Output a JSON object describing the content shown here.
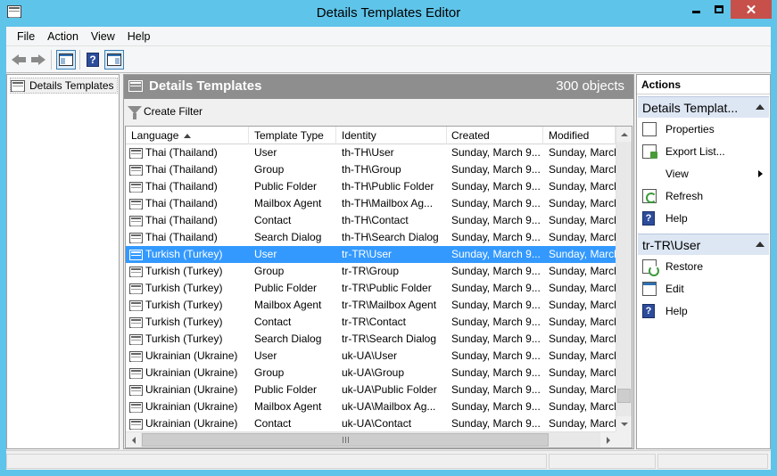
{
  "window": {
    "title": "Details Templates Editor"
  },
  "menu": [
    {
      "label": "File"
    },
    {
      "label": "Action"
    },
    {
      "label": "View"
    },
    {
      "label": "Help"
    }
  ],
  "toolbar": {
    "back_icon": "back-arrow-icon",
    "forward_icon": "forward-arrow-icon",
    "show_hide_console_tree_icon": "console-tree-icon",
    "help_icon": "help-icon",
    "show_hide_action_pane_icon": "action-pane-icon",
    "help_glyph": "?"
  },
  "tree": {
    "items": [
      {
        "label": "Details Templates"
      }
    ]
  },
  "result_pane": {
    "title": "Details Templates",
    "count": "300 objects",
    "create_filter": "Create Filter"
  },
  "list": {
    "columns": [
      {
        "label": "Language",
        "sorted": "ascending"
      },
      {
        "label": "Template Type"
      },
      {
        "label": "Identity"
      },
      {
        "label": "Created"
      },
      {
        "label": "Modified"
      }
    ],
    "rows": [
      {
        "language": "Thai (Thailand)",
        "type": "User",
        "identity": "th-TH\\User",
        "created": "Sunday, March 9...",
        "modified": "Sunday, March"
      },
      {
        "language": "Thai (Thailand)",
        "type": "Group",
        "identity": "th-TH\\Group",
        "created": "Sunday, March 9...",
        "modified": "Sunday, March"
      },
      {
        "language": "Thai (Thailand)",
        "type": "Public Folder",
        "identity": "th-TH\\Public Folder",
        "created": "Sunday, March 9...",
        "modified": "Sunday, March"
      },
      {
        "language": "Thai (Thailand)",
        "type": "Mailbox Agent",
        "identity": "th-TH\\Mailbox Ag...",
        "created": "Sunday, March 9...",
        "modified": "Sunday, March"
      },
      {
        "language": "Thai (Thailand)",
        "type": "Contact",
        "identity": "th-TH\\Contact",
        "created": "Sunday, March 9...",
        "modified": "Sunday, March"
      },
      {
        "language": "Thai (Thailand)",
        "type": "Search Dialog",
        "identity": "th-TH\\Search Dialog",
        "created": "Sunday, March 9...",
        "modified": "Sunday, March"
      },
      {
        "language": "Turkish (Turkey)",
        "type": "User",
        "identity": "tr-TR\\User",
        "created": "Sunday, March 9...",
        "modified": "Sunday, March",
        "selected": true
      },
      {
        "language": "Turkish (Turkey)",
        "type": "Group",
        "identity": "tr-TR\\Group",
        "created": "Sunday, March 9...",
        "modified": "Sunday, March"
      },
      {
        "language": "Turkish (Turkey)",
        "type": "Public Folder",
        "identity": "tr-TR\\Public Folder",
        "created": "Sunday, March 9...",
        "modified": "Sunday, March"
      },
      {
        "language": "Turkish (Turkey)",
        "type": "Mailbox Agent",
        "identity": "tr-TR\\Mailbox Agent",
        "created": "Sunday, March 9...",
        "modified": "Sunday, March"
      },
      {
        "language": "Turkish (Turkey)",
        "type": "Contact",
        "identity": "tr-TR\\Contact",
        "created": "Sunday, March 9...",
        "modified": "Sunday, March"
      },
      {
        "language": "Turkish (Turkey)",
        "type": "Search Dialog",
        "identity": "tr-TR\\Search Dialog",
        "created": "Sunday, March 9...",
        "modified": "Sunday, March"
      },
      {
        "language": "Ukrainian (Ukraine)",
        "type": "User",
        "identity": "uk-UA\\User",
        "created": "Sunday, March 9...",
        "modified": "Sunday, March"
      },
      {
        "language": "Ukrainian (Ukraine)",
        "type": "Group",
        "identity": "uk-UA\\Group",
        "created": "Sunday, March 9...",
        "modified": "Sunday, March"
      },
      {
        "language": "Ukrainian (Ukraine)",
        "type": "Public Folder",
        "identity": "uk-UA\\Public Folder",
        "created": "Sunday, March 9...",
        "modified": "Sunday, March"
      },
      {
        "language": "Ukrainian (Ukraine)",
        "type": "Mailbox Agent",
        "identity": "uk-UA\\Mailbox Ag...",
        "created": "Sunday, March 9...",
        "modified": "Sunday, March"
      },
      {
        "language": "Ukrainian (Ukraine)",
        "type": "Contact",
        "identity": "uk-UA\\Contact",
        "created": "Sunday, March 9...",
        "modified": "Sunday, March"
      }
    ],
    "selected_color": "#3399ff"
  },
  "actions": {
    "title": "Actions",
    "section1": {
      "title": "Details Templat...",
      "items": [
        {
          "label": "Properties",
          "icon": "properties-icon"
        },
        {
          "label": "Export List...",
          "icon": "export-list-icon"
        },
        {
          "label": "View",
          "icon": "",
          "submenu": true
        },
        {
          "label": "Refresh",
          "icon": "refresh-icon"
        },
        {
          "label": "Help",
          "icon": "help-icon"
        }
      ]
    },
    "section2": {
      "title": "tr-TR\\User",
      "items": [
        {
          "label": "Restore",
          "icon": "restore-icon"
        },
        {
          "label": "Edit",
          "icon": "edit-icon"
        },
        {
          "label": "Help",
          "icon": "help-icon"
        }
      ]
    }
  },
  "colors": {
    "title_bar": "#5fc4e9",
    "close_button": "#c7504a",
    "result_header": "#8e8e8e",
    "action_section": "#dde6f3"
  },
  "scroll": {
    "vertical_position": 0.95
  }
}
